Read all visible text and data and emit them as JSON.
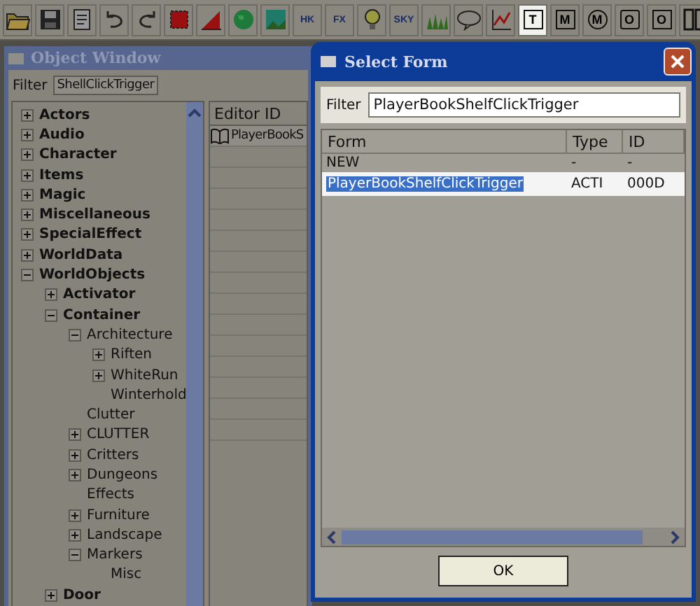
{
  "toolbar": [
    {
      "kind": "open"
    },
    {
      "kind": "save"
    },
    {
      "kind": "props"
    },
    {
      "kind": "undo"
    },
    {
      "kind": "redo"
    },
    {
      "kind": "red-square"
    },
    {
      "kind": "red-angle"
    },
    {
      "kind": "globe"
    },
    {
      "kind": "landscape"
    },
    {
      "kind": "letters",
      "label": "HK"
    },
    {
      "kind": "letters",
      "label": "FX"
    },
    {
      "kind": "bulb"
    },
    {
      "kind": "letters",
      "label": "SKY"
    },
    {
      "kind": "grass"
    },
    {
      "kind": "speech"
    },
    {
      "kind": "graph"
    },
    {
      "kind": "box",
      "label": "T",
      "selected": true
    },
    {
      "kind": "box",
      "label": "M",
      "selected": false
    },
    {
      "kind": "circle",
      "label": "M"
    },
    {
      "kind": "square",
      "label": "O"
    },
    {
      "kind": "box",
      "label": "O",
      "selected": false
    },
    {
      "kind": "panes"
    }
  ],
  "object_window": {
    "title": "Object Window",
    "filter_label": "Filter",
    "filter_value": "ShellClickTrigger",
    "tree": [
      {
        "label": "Actors",
        "expanded": false
      },
      {
        "label": "Audio",
        "expanded": false
      },
      {
        "label": "Character",
        "expanded": false
      },
      {
        "label": "Items",
        "expanded": false
      },
      {
        "label": "Magic",
        "expanded": false
      },
      {
        "label": "Miscellaneous",
        "expanded": false
      },
      {
        "label": "SpecialEffect",
        "expanded": false
      },
      {
        "label": "WorldData",
        "expanded": false
      },
      {
        "label": "WorldObjects",
        "expanded": true,
        "children": [
          {
            "label": "Activator",
            "expanded": false
          },
          {
            "label": "Container",
            "expanded": true,
            "children": [
              {
                "label": "Architecture",
                "expanded": true,
                "children": [
                  {
                    "label": "Riften",
                    "expanded": false
                  },
                  {
                    "label": "WhiteRun",
                    "expanded": false
                  },
                  {
                    "label": "Winterhold"
                  }
                ]
              },
              {
                "label": "Clutter"
              },
              {
                "label": "CLUTTER",
                "expanded": false
              },
              {
                "label": "Critters",
                "expanded": false
              },
              {
                "label": "Dungeons",
                "expanded": false
              },
              {
                "label": "Effects"
              },
              {
                "label": "Furniture",
                "expanded": false
              },
              {
                "label": "Landscape",
                "expanded": false
              },
              {
                "label": "Markers",
                "expanded": true,
                "children": [
                  {
                    "label": "Misc"
                  }
                ]
              }
            ]
          },
          {
            "label": "Door",
            "expanded": false
          }
        ]
      }
    ],
    "list": {
      "columns": [
        "Editor ID"
      ],
      "rows": [
        "PlayerBookS"
      ]
    }
  },
  "dialog": {
    "title": "Select Form",
    "filter_label": "Filter",
    "filter_value": "PlayerBookShelfClickTrigger",
    "columns": [
      "Form",
      "Type",
      "ID"
    ],
    "rows": [
      {
        "cells": [
          "NEW",
          "-",
          "-"
        ],
        "selected": false
      },
      {
        "cells": [
          "PlayerBookShelfClickTrigger",
          "ACTI",
          "000D"
        ],
        "selected": true
      }
    ],
    "buttons": [
      "OK"
    ]
  }
}
